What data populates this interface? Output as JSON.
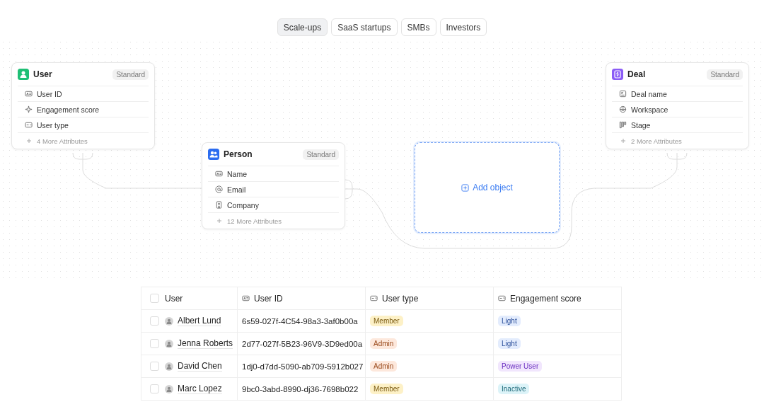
{
  "tabs": [
    {
      "label": "Scale-ups",
      "selected": true
    },
    {
      "label": "SaaS startups",
      "selected": false
    },
    {
      "label": "SMBs",
      "selected": false
    },
    {
      "label": "Investors",
      "selected": false
    }
  ],
  "objects": [
    {
      "name": "User",
      "badge": "Standard",
      "color": "#1fbf75",
      "kind": "user",
      "attributes": [
        {
          "label": "User ID",
          "kind": "id"
        },
        {
          "label": "Engagement score",
          "kind": "score"
        },
        {
          "label": "User type",
          "kind": "select"
        }
      ],
      "more": "4 More Attributes"
    },
    {
      "name": "Person",
      "badge": "Standard",
      "color": "#2b6cf0",
      "kind": "people",
      "attributes": [
        {
          "label": "Name",
          "kind": "card"
        },
        {
          "label": "Email",
          "kind": "email"
        },
        {
          "label": "Company",
          "kind": "company"
        }
      ],
      "more": "12 More Attributes"
    },
    {
      "name": "Deal",
      "badge": "Standard",
      "color": "#8b5cf6",
      "kind": "deal",
      "attributes": [
        {
          "label": "Deal name",
          "kind": "text"
        },
        {
          "label": "Workspace",
          "kind": "workspace"
        },
        {
          "label": "Stage",
          "kind": "stage"
        }
      ],
      "more": "2 More Attributes"
    }
  ],
  "add_object": {
    "label": "Add object"
  },
  "table": {
    "all_selected": false,
    "columns": [
      {
        "label": "User",
        "kind": "check"
      },
      {
        "label": "User ID",
        "kind": "id"
      },
      {
        "label": "User type",
        "kind": "select"
      },
      {
        "label": "Engagement score",
        "kind": "select"
      }
    ],
    "rows": [
      {
        "selected": false,
        "user": "Albert Lund",
        "user_id": "6s59-027f-4C54-98a3-3af0b00a",
        "user_type": {
          "label": "Member",
          "color": "#fdf1c7"
        },
        "engagement": {
          "label": "Light",
          "color": "#e3ecfd"
        }
      },
      {
        "selected": false,
        "user": "Jenna Roberts",
        "user_id": "2d77-027f-5B23-96V9-3D9ed00a",
        "user_type": {
          "label": "Admin",
          "color": "#fde8dc"
        },
        "engagement": {
          "label": "Light",
          "color": "#e3ecfd"
        }
      },
      {
        "selected": false,
        "user": "David Chen",
        "user_id": "1dj0-d7dd-5090-ab709-5912b027",
        "user_type": {
          "label": "Admin",
          "color": "#fde8dc"
        },
        "engagement": {
          "label": "Power User",
          "color": "#f1e6fd"
        }
      },
      {
        "selected": false,
        "user": "Marc Lopez",
        "user_id": "9bc0-3abd-8990-dj36-7698b022",
        "user_type": {
          "label": "Member",
          "color": "#fdf1c7"
        },
        "engagement": {
          "label": "Inactive",
          "color": "#dcf3f8"
        }
      }
    ]
  }
}
